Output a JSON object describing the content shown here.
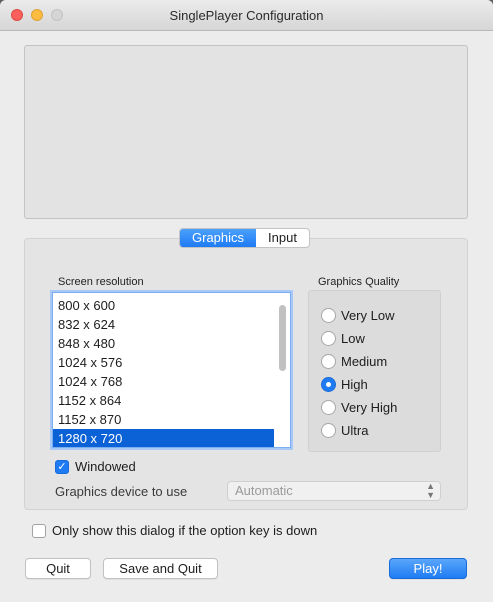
{
  "window": {
    "title": "SinglePlayer Configuration"
  },
  "tabs": [
    {
      "label": "Graphics",
      "active": true
    },
    {
      "label": "Input",
      "active": false
    }
  ],
  "resolution": {
    "label": "Screen resolution",
    "items": [
      "800 x 600",
      "832 x 624",
      "848 x 480",
      "1024 x 576",
      "1024 x 768",
      "1152 x 864",
      "1152 x 870",
      "1280 x 720"
    ],
    "selected": "1280 x 720"
  },
  "quality": {
    "label": "Graphics Quality",
    "options": [
      "Very Low",
      "Low",
      "Medium",
      "High",
      "Very High",
      "Ultra"
    ],
    "selected": "High"
  },
  "windowed": {
    "label": "Windowed",
    "checked": true
  },
  "device": {
    "label": "Graphics device to use",
    "value": "Automatic"
  },
  "option_key": {
    "label": "Only show this dialog if the option key is down",
    "checked": false
  },
  "buttons": {
    "quit": "Quit",
    "save_quit": "Save and Quit",
    "play": "Play!"
  },
  "colors": {
    "accent": "#1e7bf4",
    "selection": "#0b62d6"
  }
}
